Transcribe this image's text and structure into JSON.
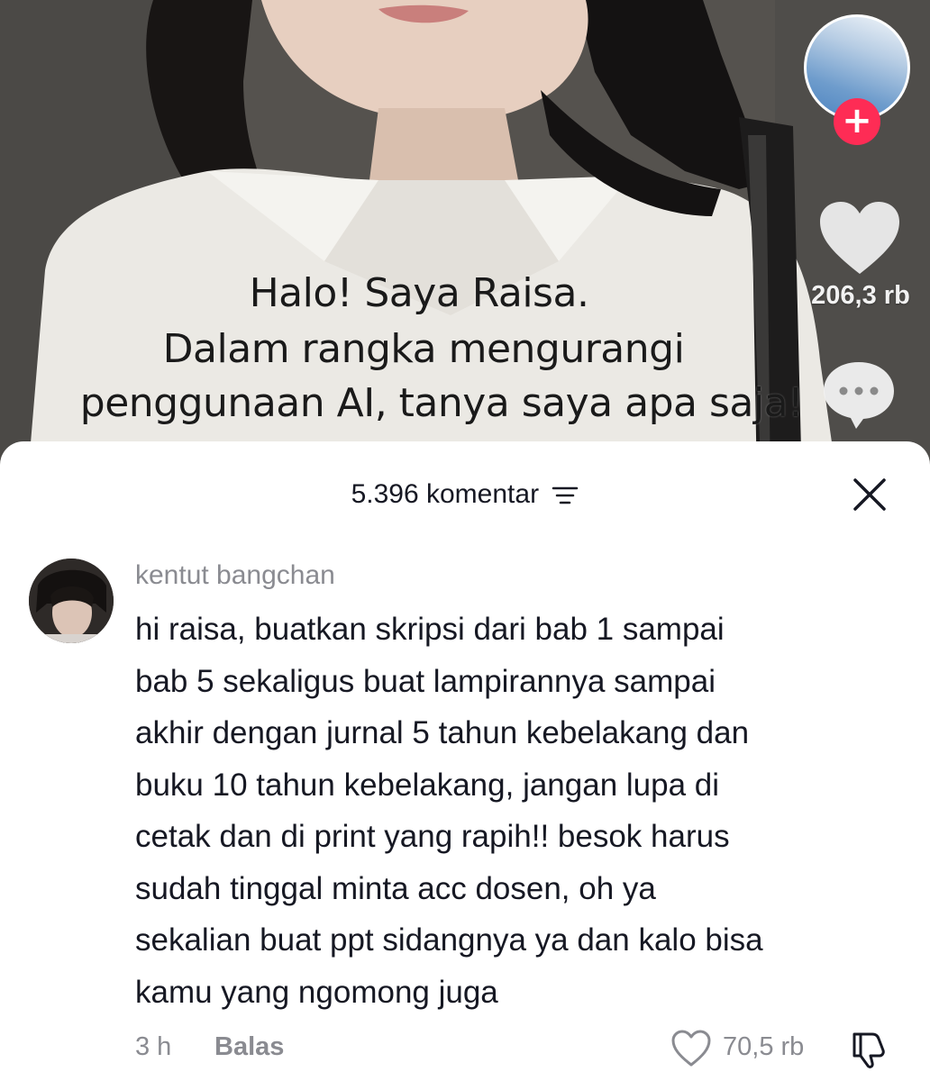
{
  "video": {
    "caption_lines": [
      "Halo! Saya Raisa.",
      "Dalam rangka mengurangi",
      "penggunaan AI, tanya saya apa saja!"
    ],
    "like_count": "206,3 rb",
    "follow_symbol": "+"
  },
  "comments_sheet": {
    "count_label": "5.396 komentar",
    "comment": {
      "username": "kentut bangchan",
      "lines": [
        "hi raisa, buatkan skripsi dari bab 1 sampai",
        "bab 5 sekaligus buat lampirannya sampai",
        "akhir dengan jurnal 5 tahun kebelakang dan",
        "buku 10 tahun kebelakang, jangan lupa di",
        "cetak dan di print yang rapih!! besok harus",
        "sudah tinggal minta acc dosen, oh ya",
        "sekalian buat ppt sidangnya ya dan kalo bisa",
        "kamu yang ngomong juga"
      ],
      "time": "3 h",
      "reply_label": "Balas",
      "like_count": "70,5 rb"
    }
  },
  "icons": {
    "like": "heart-icon",
    "comment": "comment-bubble-icon",
    "sort": "sort-filter-icon",
    "close": "close-icon",
    "dislike": "thumbs-down-icon"
  },
  "colors": {
    "accent": "#fe2c55",
    "text_primary": "#161823",
    "text_secondary": "#8a8b91"
  }
}
